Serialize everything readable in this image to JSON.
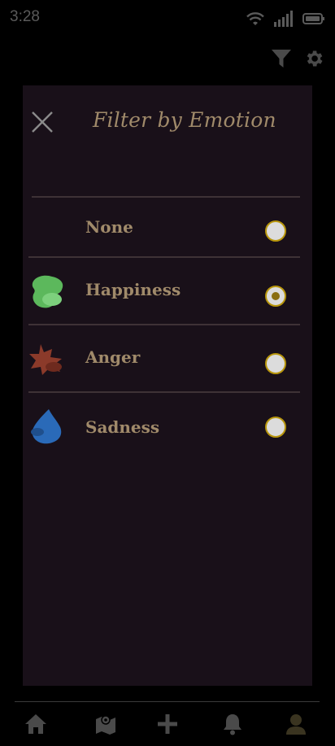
{
  "status_bar": {
    "time": "3:28",
    "icons": [
      "wifi-icon",
      "signal-icon",
      "battery-icon"
    ]
  },
  "top_actions": {
    "icons": [
      "filter-icon",
      "gear-icon"
    ]
  },
  "filter_panel": {
    "title": "Filter by Emotion",
    "close_icon": "close-icon",
    "options": [
      {
        "label": "None",
        "icon": null,
        "selected": false
      },
      {
        "label": "Happiness",
        "icon": "happiness-blob-icon",
        "color": "#5cb85c",
        "selected": true
      },
      {
        "label": "Anger",
        "icon": "anger-splat-icon",
        "color": "#8b3a2a",
        "selected": false
      },
      {
        "label": "Sadness",
        "icon": "sadness-drop-icon",
        "color": "#2a6ab8",
        "selected": false
      }
    ]
  },
  "bottom_nav": {
    "items": [
      "home-icon",
      "map-icon",
      "add-icon",
      "bell-icon",
      "profile-icon"
    ],
    "active_item": "profile-icon"
  },
  "colors": {
    "background": "#000000",
    "panel": "#191019",
    "text_accent": "#a08a6a",
    "radio_border": "#b8960c",
    "icon_grey": "#5a5a5a",
    "nav_active": "#3a3420"
  }
}
